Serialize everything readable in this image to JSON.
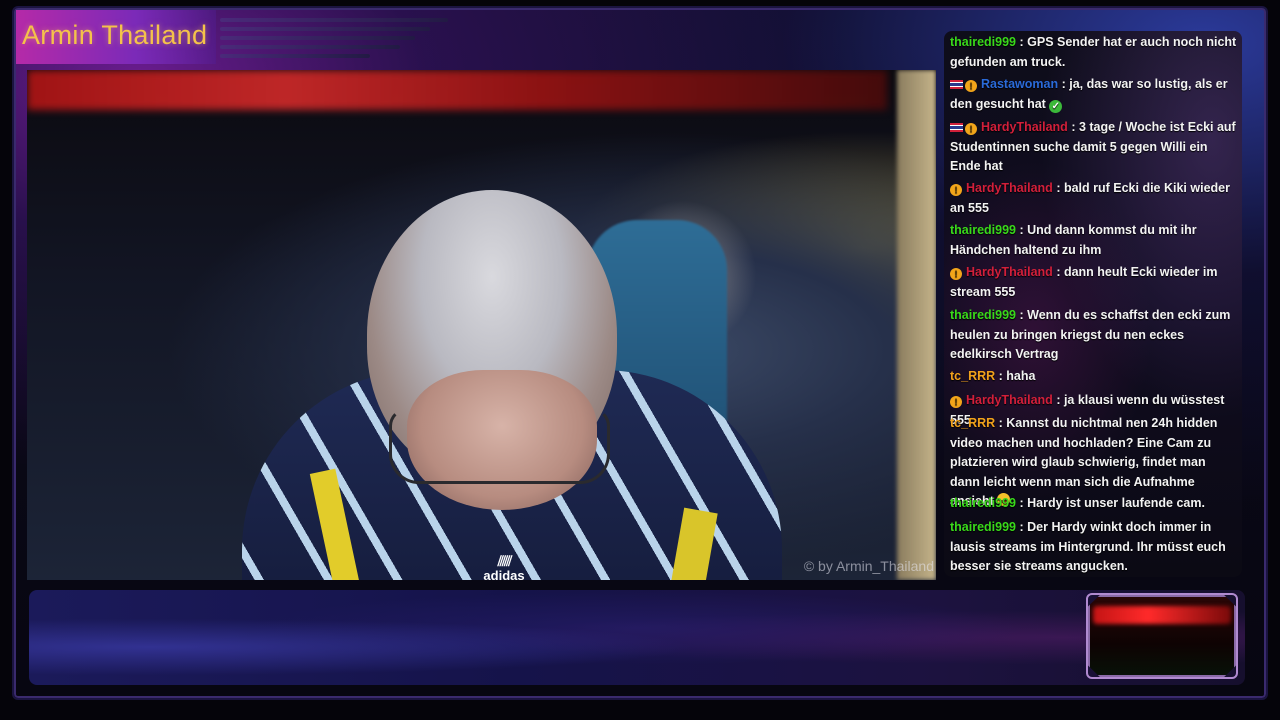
{
  "stream": {
    "title": "Armin Thailand",
    "watermark": "© by Armin_Thailand",
    "shirt_logo": "adidas"
  },
  "chat": {
    "messages": [
      {
        "user": "thairedi999",
        "color": "green",
        "badges": [],
        "text": ": GPS Sender hat er auch noch nicht gefunden am truck."
      },
      {
        "user": "Rastawoman",
        "color": "blue",
        "badges": [
          "flag",
          "coin"
        ],
        "text": ": ja, das war so lustig, als er den gesucht hat",
        "emoji": "check"
      },
      {
        "user": "HardyThailand",
        "color": "red",
        "badges": [
          "flag",
          "coin"
        ],
        "text": ": 3 tage / Woche ist Ecki auf Studentinnen suche damit 5 gegen Willi ein Ende hat"
      },
      {
        "user": "HardyThailand",
        "color": "red",
        "badges": [
          "coin"
        ],
        "text": ": bald ruf Ecki die Kiki wieder an 555"
      },
      {
        "user": "thairedi999",
        "color": "green",
        "badges": [],
        "text": ": Und dann kommst du mit ihr Händchen haltend zu ihm"
      },
      {
        "user": "HardyThailand",
        "color": "red",
        "badges": [
          "coin"
        ],
        "text": ": dann heult Ecki wieder im stream 555"
      },
      {
        "user": "thairedi999",
        "color": "green",
        "badges": [],
        "text": ": Wenn du es schaffst den ecki zum heulen zu bringen kriegst du nen eckes edelkirsch Vertrag"
      },
      {
        "user": "tc_RRR",
        "color": "orange",
        "badges": [],
        "text": ": haha"
      },
      {
        "user": "HardyThailand",
        "color": "red",
        "badges": [
          "coin"
        ],
        "text": ": ja klausi wenn du wüsstest 555"
      },
      {
        "user": "tc_RRR",
        "color": "orange",
        "badges": [],
        "text": ": Kannst du nichtmal nen 24h hidden video machen und hochladen? Eine Cam zu platzieren wird glaub schwierig, findet man dann leicht wenn man sich die Aufnahme ansieht",
        "emoji": "laugh"
      },
      {
        "user": "thairedi999",
        "color": "green",
        "badges": [],
        "text": ": Hardy ist unser laufende cam."
      },
      {
        "user": "thairedi999",
        "color": "green",
        "badges": [],
        "text": ": Der Hardy winkt doch immer in lausis streams im Hintergrund. Ihr müsst euch besser sie streams angucken."
      }
    ]
  },
  "colors": {
    "title": "#f4c24a",
    "user_green": "#39d81a",
    "user_blue": "#2a6ad8",
    "user_red": "#d21f3a",
    "user_orange": "#f0a11c"
  }
}
